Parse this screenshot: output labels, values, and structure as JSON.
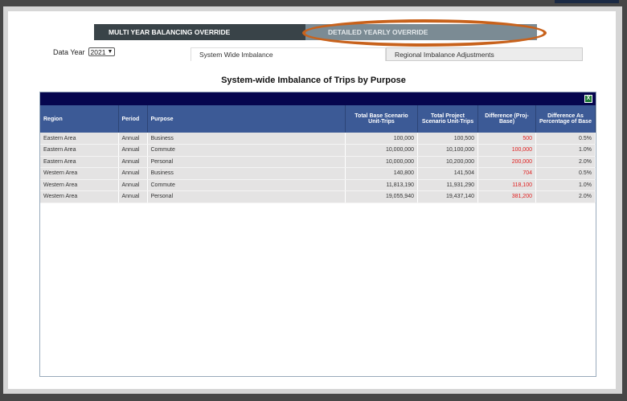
{
  "tabs": {
    "multi": "MULTI YEAR BALANCING OVERRIDE",
    "detailed": "DETAILED YEARLY OVERRIDE"
  },
  "data_year": {
    "label": "Data Year",
    "value": "2021"
  },
  "subtabs": {
    "system": "System Wide Imbalance",
    "regional": "Regional Imbalance Adjustments"
  },
  "title": "System-wide Imbalance of Trips by Purpose",
  "export_icon": "X",
  "columns": [
    "Region",
    "Period",
    "Purpose",
    "Total Base Scenario Unit-Trips",
    "Total Project Scenario Unit-Trips",
    "Difference (Proj-Base)",
    "Difference As Percentage of Base"
  ],
  "rows": [
    [
      "Eastern Area",
      "Annual",
      "Business",
      "100,000",
      "100,500",
      "500",
      "0.5%"
    ],
    [
      "Eastern Area",
      "Annual",
      "Commute",
      "10,000,000",
      "10,100,000",
      "100,000",
      "1.0%"
    ],
    [
      "Eastern Area",
      "Annual",
      "Personal",
      "10,000,000",
      "10,200,000",
      "200,000",
      "2.0%"
    ],
    [
      "Western Area",
      "Annual",
      "Business",
      "140,800",
      "141,504",
      "704",
      "0.5%"
    ],
    [
      "Western Area",
      "Annual",
      "Commute",
      "11,813,190",
      "11,931,290",
      "118,100",
      "1.0%"
    ],
    [
      "Western Area",
      "Annual",
      "Personal",
      "19,055,940",
      "19,437,140",
      "381,200",
      "2.0%"
    ]
  ]
}
